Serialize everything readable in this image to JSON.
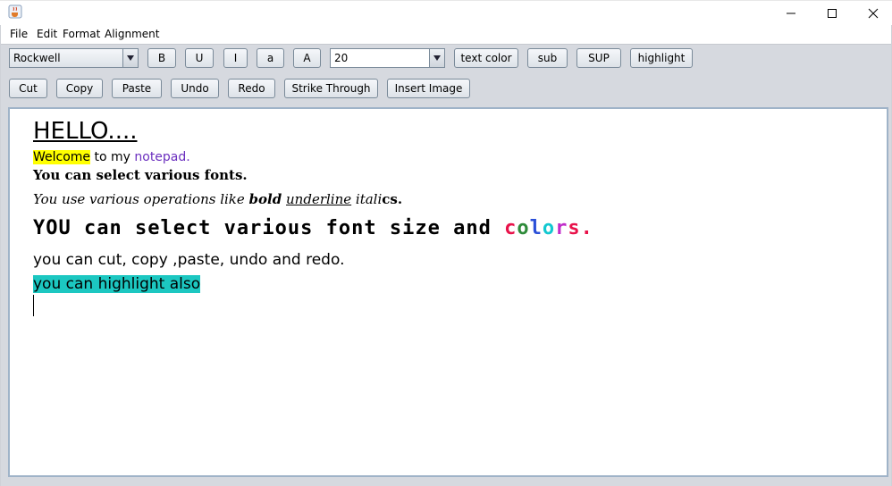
{
  "window": {
    "icon": "java-cup-icon",
    "controls": {
      "minimize": "minimize-icon",
      "maximize": "maximize-icon",
      "close": "close-icon"
    }
  },
  "menu": [
    "File",
    "Edit",
    "Format",
    "Alignment"
  ],
  "toolbar": {
    "font_select": "Rockwell",
    "bold": "B",
    "underline": "U",
    "italic": "I",
    "lower": "a",
    "upper": "A",
    "size_select": "20",
    "text_color": "text color",
    "sub": "sub",
    "sup": "SUP",
    "highlight": "highlight"
  },
  "actions": {
    "cut": "Cut",
    "copy": "Copy",
    "paste": "Paste",
    "undo": "Undo",
    "redo": "Redo",
    "strike": "Strike Through",
    "insert_image": "Insert Image"
  },
  "document": {
    "line1": "HELLO....",
    "line2": {
      "highlighted": "Welcome",
      "middle": " to my ",
      "colored": "notepad."
    },
    "line3": "You can select various fonts.",
    "line4": {
      "a": "You use various operations like ",
      "bold": "bold",
      "sp1": " ",
      "underline": "underline",
      "sp2": " ",
      "ital": "itali",
      "rest": "cs."
    },
    "line5": {
      "text": "YOU can select various font size and ",
      "c": "c",
      "o": "o",
      "l": "l",
      "o2": "o",
      "r": "r",
      "s": "s",
      "dot": "."
    },
    "line6": "you can cut, copy ,paste, undo and redo.",
    "line7": "you can highlight also"
  },
  "colors": {
    "highlight_yellow": "#ffff00",
    "notepad_purple": "#6b2fbf",
    "highlight_teal": "#1cc7c1",
    "c_red": "#e8124a",
    "o_green": "#2e8b3a",
    "l_blue": "#2a4fd8",
    "o_cyan": "#12c8d0",
    "r_magenta": "#c02bc9",
    "s_red": "#e8124a"
  }
}
